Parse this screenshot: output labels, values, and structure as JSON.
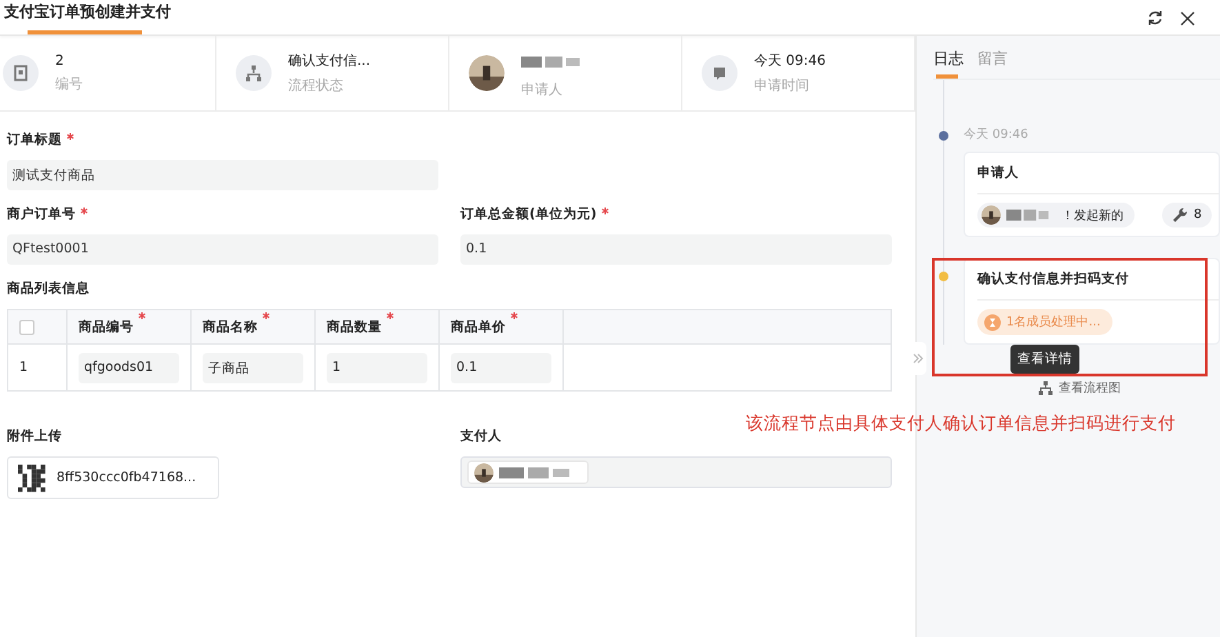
{
  "window": {
    "title": "支付宝订单预创建并支付"
  },
  "summary": [
    {
      "kind": "badge",
      "value": "2",
      "label": "编号"
    },
    {
      "kind": "tree",
      "value": "确认支付信...",
      "label": "流程状态"
    },
    {
      "kind": "avatar",
      "label": "申请人"
    },
    {
      "kind": "note",
      "value": "今天 09:46",
      "label": "申请时间"
    }
  ],
  "form": {
    "title": {
      "label": "订单标题",
      "required": true,
      "value": "测试支付商品"
    },
    "merchant_order_no": {
      "label": "商户订单号",
      "required": true,
      "value": "QFtest0001"
    },
    "total_amount": {
      "label": "订单总金额(单位为元)",
      "required": true,
      "value": "0.1"
    },
    "items": {
      "label": "商品列表信息",
      "select_all": {
        "checked": false
      },
      "columns": [
        {
          "label": "商品编号",
          "required": true
        },
        {
          "label": "商品名称",
          "required": true
        },
        {
          "label": "商品数量",
          "required": true
        },
        {
          "label": "商品单价",
          "required": true
        }
      ],
      "rows": [
        {
          "index": "1",
          "cells": [
            "qfgoods01",
            "子商品",
            "1",
            "0.1"
          ]
        }
      ]
    },
    "attachment": {
      "label": "附件上传",
      "file_name": "8ff530ccc0fb47168..."
    },
    "payer": {
      "label": "支付人"
    }
  },
  "side": {
    "tabs": [
      {
        "label": "日志",
        "selected": true
      },
      {
        "label": "留言",
        "selected": false
      }
    ],
    "timeline": [
      {
        "time": "今天 09:46",
        "title": "申请人",
        "color": "#5b6f9e",
        "action": "！发起新的",
        "count": "8"
      },
      {
        "title": "确认支付信息并扫码支付",
        "color": "#f2bd42",
        "status": "1名成员处理中..."
      }
    ],
    "tooltip": "查看详情",
    "flow_link": "查看流程图"
  },
  "annotation": "该流程节点由具体支付人确认订单信息并扫码进行支付"
}
